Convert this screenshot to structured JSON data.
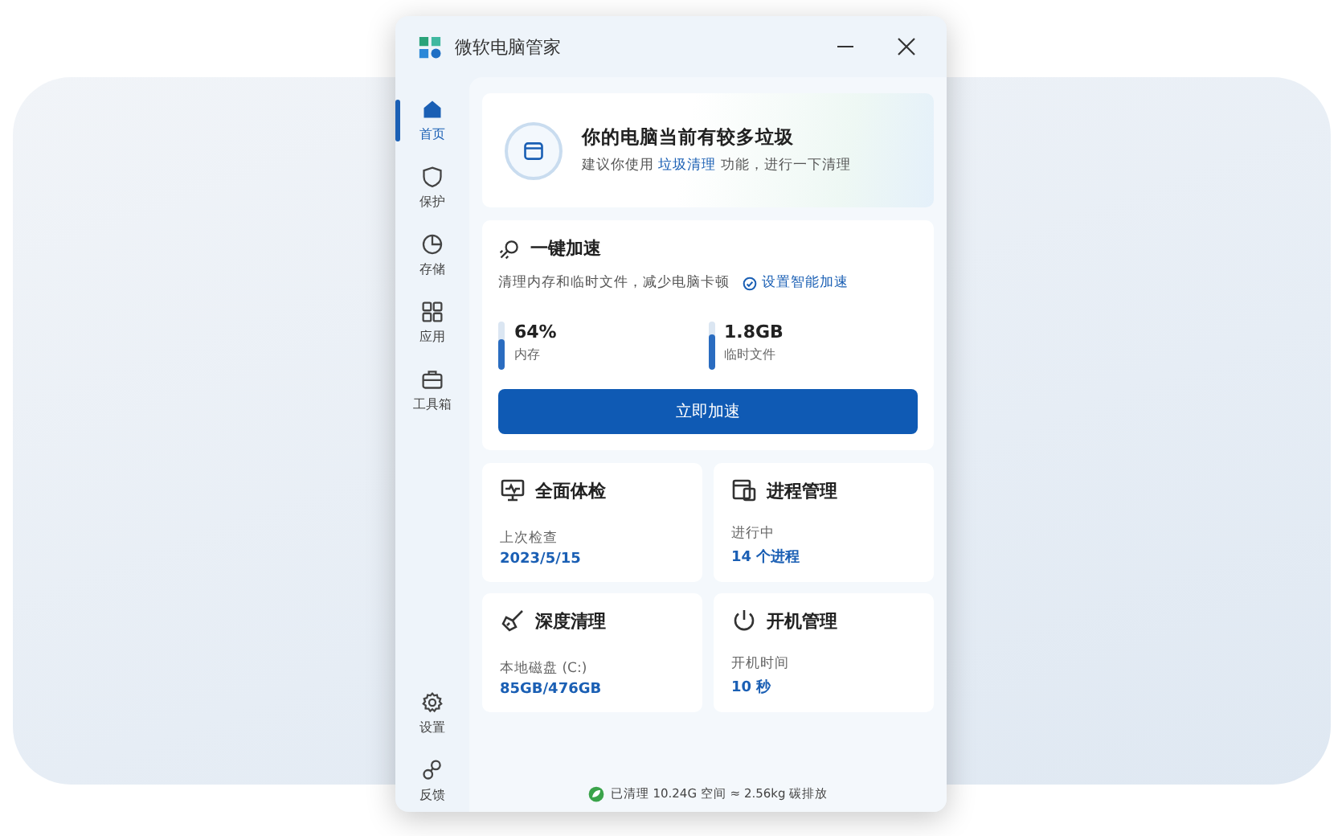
{
  "window": {
    "title": "微软电脑管家"
  },
  "sidebar": {
    "items": [
      {
        "kind": "home",
        "label": "首页",
        "selected": true
      },
      {
        "kind": "shield",
        "label": "保护",
        "selected": false
      },
      {
        "kind": "pie",
        "label": "存储",
        "selected": false
      },
      {
        "kind": "apps",
        "label": "应用",
        "selected": false
      },
      {
        "kind": "toolbox",
        "label": "工具箱",
        "selected": false
      }
    ],
    "bottom_items": [
      {
        "kind": "gear",
        "label": "设置",
        "selected": false
      },
      {
        "kind": "feedback",
        "label": "反馈",
        "selected": false
      }
    ]
  },
  "banner": {
    "title": "你的电脑当前有较多垃圾",
    "text_before": "建议你使用",
    "link": "垃圾清理",
    "text_after": "功能，进行一下清理"
  },
  "boost": {
    "title": "一键加速",
    "description": "清理内存和临时文件，减少电脑卡顿",
    "link": "设置智能加速",
    "meters": [
      {
        "value": "64%",
        "label": "内存",
        "level": 0.64
      },
      {
        "value": "1.8GB",
        "label": "临时文件",
        "level": 0.75
      }
    ],
    "button": "立即加速"
  },
  "tiles": [
    {
      "kind": "checkup",
      "title": "全面体检",
      "label": "上次检查",
      "value": "2023/5/15"
    },
    {
      "kind": "process",
      "title": "进程管理",
      "label": "进行中",
      "value": "14 个进程"
    },
    {
      "kind": "broom",
      "title": "深度清理",
      "label": "本地磁盘 (C:)",
      "value": "85GB/476GB"
    },
    {
      "kind": "power",
      "title": "开机管理",
      "label": "开机时间",
      "value": "10 秒"
    }
  ],
  "footer": {
    "text": "已清理 10.24G 空间 ≈ 2.56kg 碳排放"
  }
}
